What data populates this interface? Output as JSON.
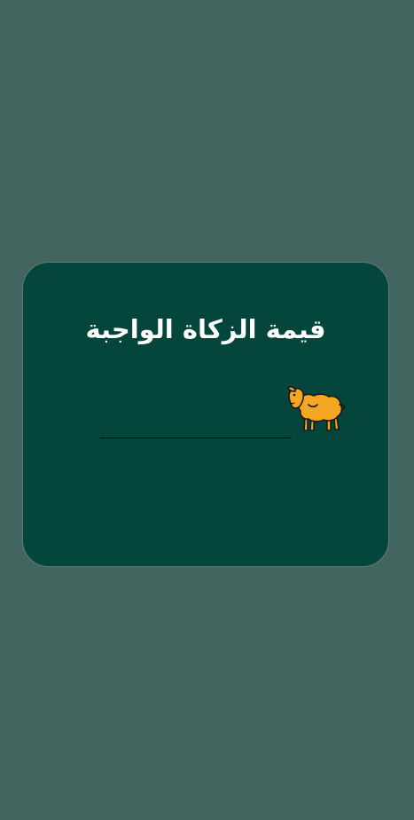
{
  "dialog": {
    "title": "قيمة الزكاة الواجبة",
    "icon": "sheep-icon",
    "field_value": ""
  },
  "colors": {
    "backdrop": "#426560",
    "dialog_background": "#04453c",
    "title_text": "#ffffff",
    "icon_fill": "#f5a623"
  }
}
